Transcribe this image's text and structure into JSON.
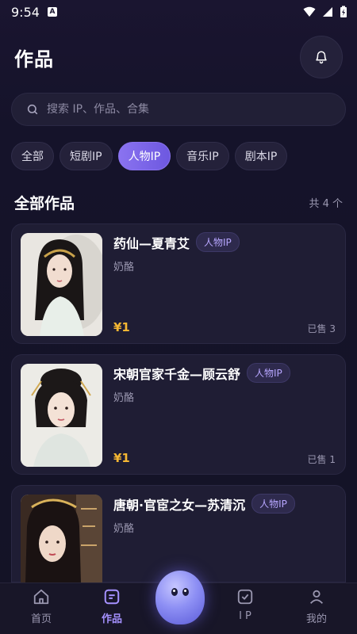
{
  "status_bar": {
    "time": "9:54",
    "badge": "A"
  },
  "header": {
    "title": "作品"
  },
  "search": {
    "placeholder": "搜索 IP、作品、合集"
  },
  "chips": [
    {
      "label": "全部",
      "active": false
    },
    {
      "label": "短剧IP",
      "active": false
    },
    {
      "label": "人物IP",
      "active": true
    },
    {
      "label": "音乐IP",
      "active": false
    },
    {
      "label": "剧本IP",
      "active": false
    }
  ],
  "section": {
    "title": "全部作品",
    "count": "共 4 个"
  },
  "works": [
    {
      "name": "药仙—夏青艾",
      "tag": "人物IP",
      "author": "奶酪",
      "price": "¥1",
      "sold": "已售 3"
    },
    {
      "name": "宋朝官家千金—顾云舒",
      "tag": "人物IP",
      "author": "奶酪",
      "price": "¥1",
      "sold": "已售 1"
    },
    {
      "name": "唐朝·官宦之女—苏清沉",
      "tag": "人物IP",
      "author": "奶酪",
      "price": "",
      "sold": ""
    }
  ],
  "tabbar": {
    "items": [
      {
        "label": "首页",
        "icon": "home-icon",
        "active": false
      },
      {
        "label": "作品",
        "icon": "works-icon",
        "active": true
      },
      {
        "label": "I P",
        "icon": "ip-icon",
        "active": false
      },
      {
        "label": "我的",
        "icon": "profile-icon",
        "active": false
      }
    ]
  },
  "colors": {
    "accent": "#8a73f0",
    "price": "#f5b733",
    "background": "#15132a"
  }
}
